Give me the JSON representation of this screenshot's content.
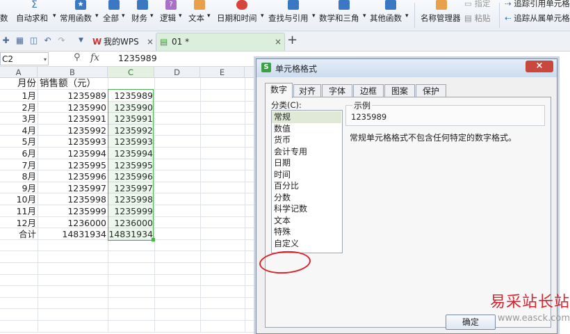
{
  "ribbon": {
    "items": [
      {
        "label": "数",
        "icon": "sum-partial-icon"
      },
      {
        "label": "自动求和",
        "icon": "sum-icon"
      },
      {
        "label": "常用函数",
        "icon": "star-function-icon"
      },
      {
        "label": "全部",
        "icon": "all-functions-icon"
      },
      {
        "label": "财务",
        "icon": "finance-icon"
      },
      {
        "label": "逻辑",
        "icon": "logic-icon"
      },
      {
        "label": "文本",
        "icon": "text-function-icon"
      },
      {
        "label": "日期和时间",
        "icon": "clock-icon"
      },
      {
        "label": "查找与引用",
        "icon": "lookup-icon"
      },
      {
        "label": "数学和三角",
        "icon": "math-icon"
      },
      {
        "label": "其他函数",
        "icon": "other-function-icon"
      },
      {
        "label": "名称管理器",
        "icon": "name-manager-icon"
      }
    ],
    "paste_label": "粘贴",
    "precedent_label": "追踪引用单元格",
    "dependent_label": "追踪从属单元格",
    "accent": "#3b78c4"
  },
  "tabs": {
    "wps_tab": "我的WPS",
    "doc_tab": "01 *",
    "close_glyph": "×",
    "add_glyph": "+"
  },
  "formula": {
    "cell_ref": "C2",
    "fx": "fx",
    "value": "1235989"
  },
  "grid": {
    "columns": [
      "A",
      "B",
      "C",
      "D",
      "E"
    ],
    "header_row": {
      "a": "月份",
      "b": "销售额（元）",
      "c": ""
    },
    "rows": [
      {
        "a": "1月",
        "b": "1235989",
        "c": "1235989"
      },
      {
        "a": "2月",
        "b": "1235990",
        "c": "1235990"
      },
      {
        "a": "3月",
        "b": "1235991",
        "c": "1235991"
      },
      {
        "a": "4月",
        "b": "1235992",
        "c": "1235992"
      },
      {
        "a": "5月",
        "b": "1235993",
        "c": "1235993"
      },
      {
        "a": "6月",
        "b": "1235994",
        "c": "1235994"
      },
      {
        "a": "7月",
        "b": "1235995",
        "c": "1235995"
      },
      {
        "a": "8月",
        "b": "1235996",
        "c": "1235996"
      },
      {
        "a": "9月",
        "b": "1235997",
        "c": "1235997"
      },
      {
        "a": "10月",
        "b": "1235998",
        "c": "1235998"
      },
      {
        "a": "11月",
        "b": "1235999",
        "c": "1235999"
      },
      {
        "a": "12月",
        "b": "1236000",
        "c": "1236000"
      },
      {
        "a": "合计",
        "b": "14831934",
        "c": "14831934"
      }
    ],
    "selection_color": "#4caf50"
  },
  "dialog": {
    "title": "单元格格式",
    "close_glyph": "×",
    "tabs": [
      "数字",
      "对齐",
      "字体",
      "边框",
      "图案",
      "保护"
    ],
    "category_label": "分类(C):",
    "categories": [
      "常规",
      "数值",
      "货币",
      "会计专用",
      "日期",
      "时间",
      "百分比",
      "分数",
      "科学记数",
      "文本",
      "特殊",
      "自定义"
    ],
    "selected_category": "常规",
    "sample_label": "示例",
    "sample_value": "1235989",
    "description": "常规单元格格式不包含任何特定的数字格式。",
    "ok_label": "确定",
    "highlight_color": "#d9232d"
  },
  "watermark": {
    "line1": "易采站长站",
    "line2": "www.easck.com"
  }
}
